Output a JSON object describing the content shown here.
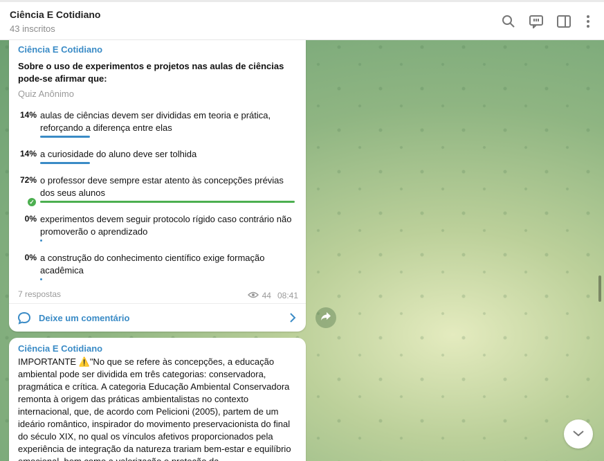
{
  "header": {
    "title": "Ciência E Cotidiano",
    "subtitle": "43 inscritos",
    "icons": [
      "search-icon",
      "discussion-icon",
      "sidebar-icon",
      "more-icon"
    ]
  },
  "quiz_post": {
    "channel": "Ciência E Cotidiano",
    "question": "Sobre o uso de experimentos e projetos nas aulas de ciências pode-se afirmar que:",
    "quiz_type": "Quiz Anônimo",
    "options": [
      {
        "percent": "14%",
        "text": "aulas de ciências devem ser divididas em teoria e prática, reforçando a diferença entre elas",
        "fill": 0.14,
        "correct": false
      },
      {
        "percent": "14%",
        "text": "a curiosidade do aluno deve ser tolhida",
        "fill": 0.14,
        "correct": false
      },
      {
        "percent": "72%",
        "text": "o professor deve sempre estar atento às concepções prévias dos seus alunos",
        "fill": 0.72,
        "correct": true
      },
      {
        "percent": "0%",
        "text": "experimentos devem seguir protocolo rígido caso contrário não promoverão o aprendizado",
        "fill": 0,
        "correct": false
      },
      {
        "percent": "0%",
        "text": "a construção do conhecimento científico exige formação acadêmica",
        "fill": 0,
        "correct": false
      }
    ],
    "responses": "7 respostas",
    "views": "44",
    "time": "08:41",
    "comment_label": "Deixe um comentário"
  },
  "text_post": {
    "channel": "Ciência E Cotidiano",
    "body": "IMPORTANTE ⚠️\"No que se refere às concepções, a educação ambiental pode ser dividida em três categorias: conservadora, pragmática e crítica. A categoria Educação Ambiental Conservadora remonta à origem das práticas ambientalistas no contexto internacional, que, de acordo com Pelicioni (2005), partem de um ideário romântico, inspirador do movimento preservacionista do final do século XIX, no qual os vínculos afetivos proporcionados pela experiência de integração da natureza trariam bem-estar e equilíbrio emocional, bem como a valorização e proteção da"
  },
  "colors": {
    "accent": "#3a8bc6",
    "bar": "#3a8bc6",
    "correct": "#4caf50"
  }
}
